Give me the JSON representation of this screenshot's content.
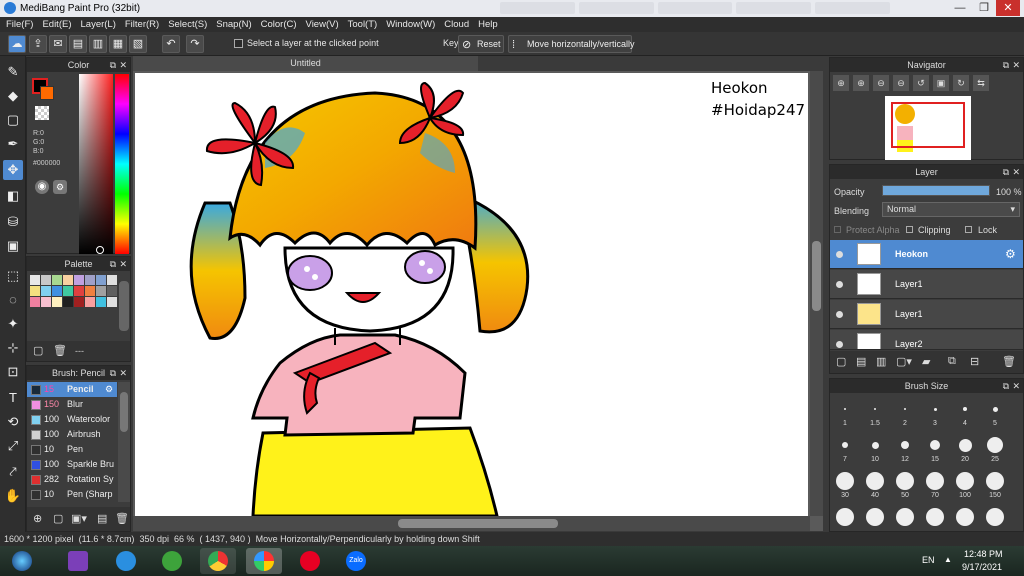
{
  "window": {
    "title": "MediBang Paint Pro (32bit)",
    "minimize": "—",
    "maximize": "❐",
    "close": "✕"
  },
  "menu": [
    "File(F)",
    "Edit(E)",
    "Layer(L)",
    "Filter(R)",
    "Select(S)",
    "Snap(N)",
    "Color(C)",
    "View(V)",
    "Tool(T)",
    "Window(W)",
    "Cloud",
    "Help"
  ],
  "toolbar": {
    "select_layer_label": "Select a layer at the clicked point",
    "key_label": "Key",
    "reset_label": "Reset",
    "move_hv_label": "Move horizontally/vertically"
  },
  "color_panel": {
    "title": "Color",
    "r": "R:0",
    "g": "G:0",
    "b": "B:0",
    "hex": "#000000",
    "current_color": "#000000",
    "secondary_color": "#ff6a00"
  },
  "palette_panel": {
    "title": "Palette",
    "swatches": [
      "#e8e8e8",
      "#c8c8c8",
      "#a8d890",
      "#f8d0a0",
      "#c0a0e0",
      "#a0a0c8",
      "#80a0d0",
      "#e0e0e0",
      "#f4e080",
      "#80d0f0",
      "#4090e0",
      "#40c8a0",
      "#e04040",
      "#f08040",
      "#a0a0a0",
      "#606060",
      "#f080a0",
      "#f8c0d0",
      "#fff0c0",
      "#202020",
      "#a02020",
      "#f8a0a0",
      "#40c0e0",
      "#e0e0e0"
    ],
    "footer_text": "---"
  },
  "brush_panel": {
    "title": "Brush: Pencil",
    "items": [
      {
        "size": "15",
        "name": "Pencil",
        "color": "#1a2a3a"
      },
      {
        "size": "150",
        "name": "Blur",
        "color": "#f090e0"
      },
      {
        "size": "100",
        "name": "Watercolor",
        "color": "#80d0f0"
      },
      {
        "size": "100",
        "name": "Airbrush",
        "color": "#d0d0d0"
      },
      {
        "size": "10",
        "name": "Pen",
        "color": "#303030"
      },
      {
        "size": "100",
        "name": "Sparkle Bru",
        "color": "#3050e0"
      },
      {
        "size": "282",
        "name": "Rotation Sy",
        "color": "#e03030"
      },
      {
        "size": "10",
        "name": "Pen (Sharp",
        "color": "#303030"
      }
    ]
  },
  "canvas": {
    "tab_title": "Untitled",
    "overlay_line1": "Heokon",
    "overlay_line2": "#Hoidap247"
  },
  "navigator": {
    "title": "Navigator"
  },
  "layer_panel": {
    "title": "Layer",
    "opacity_label": "Opacity",
    "opacity_value": "100 %",
    "opacity_fraction": 1.0,
    "blending_label": "Blending",
    "blending_value": "Normal",
    "protect_alpha": "Protect Alpha",
    "clipping": "Clipping",
    "lock": "Lock",
    "layers": [
      {
        "name": "Heokon",
        "active": true
      },
      {
        "name": "Layer1",
        "active": false
      },
      {
        "name": "Layer1",
        "active": false
      },
      {
        "name": "Layer2",
        "active": false
      }
    ]
  },
  "brush_size_panel": {
    "title": "Brush Size",
    "sizes": [
      "1",
      "1.5",
      "2",
      "3",
      "4",
      "5",
      "7",
      "10",
      "12",
      "15",
      "20",
      "25",
      "30",
      "40",
      "50",
      "70",
      "100",
      "150",
      "",
      "",
      "",
      "",
      "",
      ""
    ]
  },
  "status": {
    "dimensions": "1600 * 1200 pixel",
    "physical": "(11.6 * 8.7cm)",
    "dpi": "350 dpi",
    "zoom": "66 %",
    "coords": "( 1437, 940 )",
    "hint": "Move Horizontally/Perpendicularly by holding down Shift"
  },
  "taskbar": {
    "lang": "EN",
    "time": "12:48 PM",
    "date": "9/17/2021",
    "zalo_label": "Zalo"
  }
}
